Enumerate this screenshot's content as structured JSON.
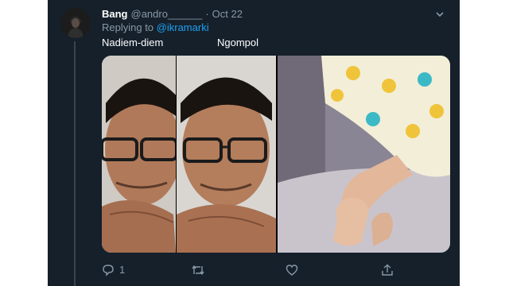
{
  "tweet": {
    "author_name": "Bang",
    "author_handle": "@andro______",
    "separator": "·",
    "date": "Oct 22",
    "replying_prefix": "Replying to ",
    "replying_to": "@ikramarki",
    "caption_left": "Nadiem-diem",
    "caption_right": "Ngompol"
  },
  "actions": {
    "reply_count": "1",
    "retweet_count": "",
    "like_count": ""
  },
  "colors": {
    "background": "#15202b",
    "text_primary": "#ffffff",
    "text_secondary": "#8899a6",
    "link": "#1da1f2",
    "thread_line": "#38444d"
  },
  "icons": [
    "chevron-down-icon",
    "reply-icon",
    "retweet-icon",
    "like-icon",
    "share-icon"
  ]
}
